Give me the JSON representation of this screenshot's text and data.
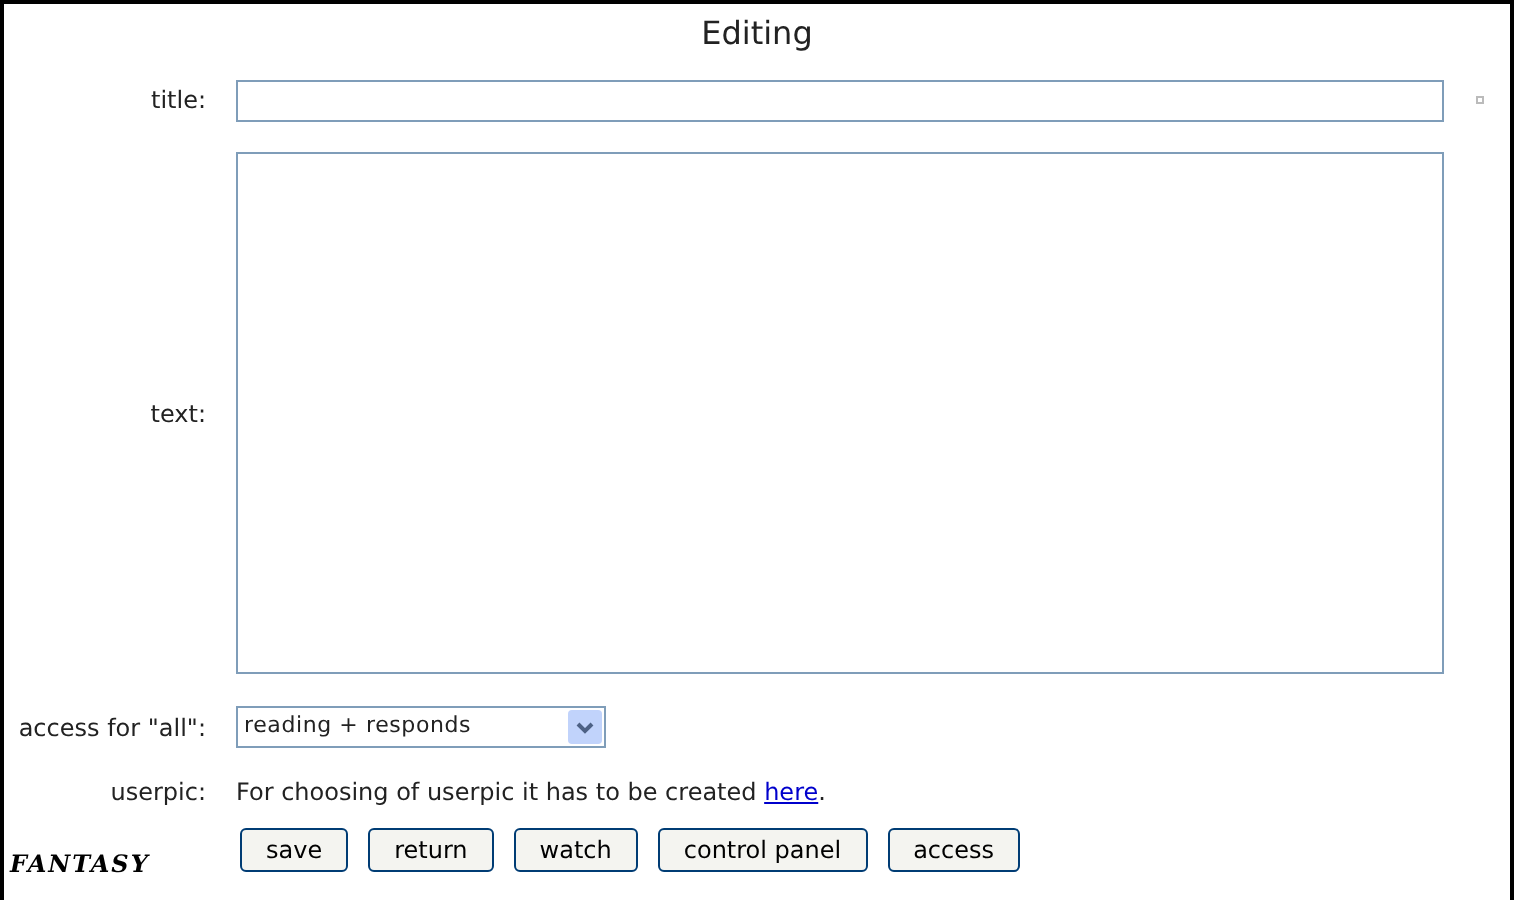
{
  "heading": "Editing",
  "title_field": {
    "label": "title:"
  },
  "text_field": {
    "label": "text:"
  },
  "access": {
    "label": "access for \"all\":",
    "value": "reading + responds"
  },
  "userpic": {
    "label": "userpic:",
    "text": "For choosing of userpic it has to be created",
    "link": "here",
    "after": "."
  },
  "logo": "FANTASY",
  "buttons": [
    "save",
    "return",
    "watch",
    "control panel",
    "access"
  ]
}
